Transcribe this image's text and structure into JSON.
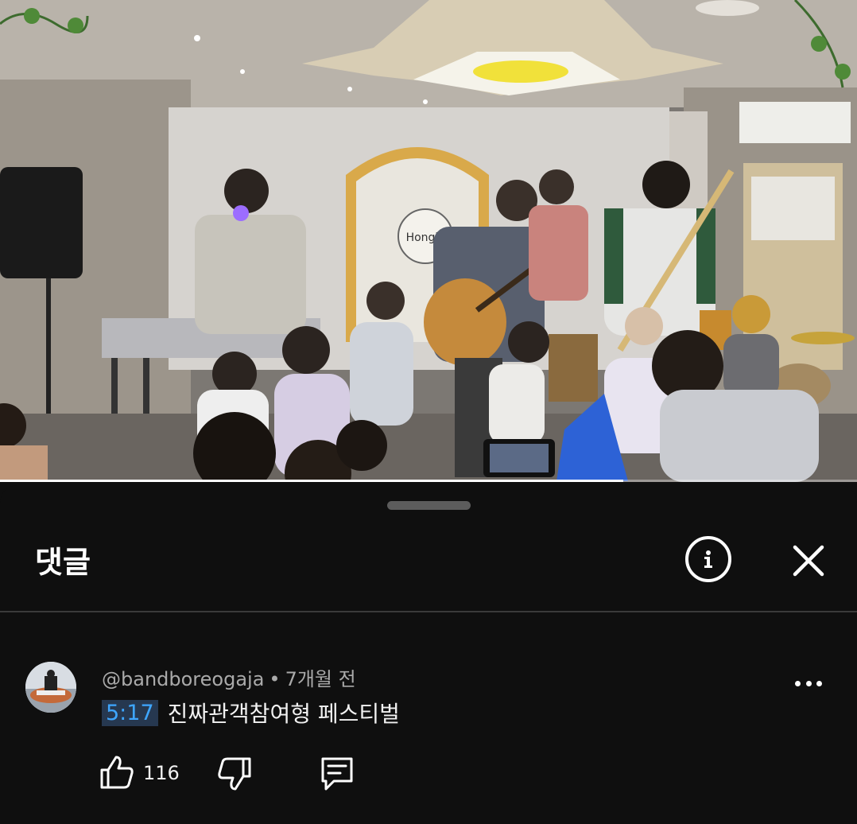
{
  "video": {
    "banner_text": "Hongik",
    "progress_fraction": 0.727
  },
  "sheet": {
    "title": "댓글",
    "icons": {
      "info": "info-icon",
      "close": "close-icon",
      "more": "more-vert-icon",
      "like": "thumb-up-icon",
      "dislike": "thumb-down-icon",
      "reply": "comment-reply-icon"
    }
  },
  "comment": {
    "author": "@bandboreogaja",
    "separator": "•",
    "time_ago": "7개월 전",
    "timestamp": "5:17",
    "text": "진짜관객참여형 페스티벌",
    "like_count": "116"
  },
  "colors": {
    "background": "#0f0f0f",
    "link": "#3ea6ff",
    "meta": "#aaaaaa"
  }
}
